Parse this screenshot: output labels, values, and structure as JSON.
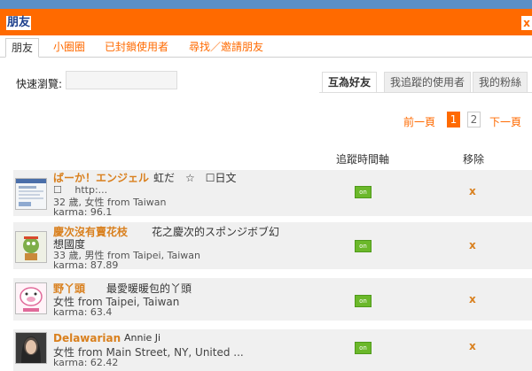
{
  "window": {
    "title": "朋友",
    "close_label": "x"
  },
  "nav_tabs": [
    {
      "label": "朋友"
    },
    {
      "label": "小圈圈"
    },
    {
      "label": "已封鎖使用者"
    },
    {
      "label": "尋找／邀請朋友"
    }
  ],
  "quick_browse": {
    "label": "快速瀏覽:",
    "value": ""
  },
  "filter_tabs": [
    {
      "label": "互為好友"
    },
    {
      "label": "我追蹤的使用者"
    },
    {
      "label": "我的粉絲"
    }
  ],
  "pager": {
    "prev": "前一頁",
    "next": "下一頁",
    "pages": [
      "1",
      "2"
    ],
    "current": "1"
  },
  "columns": {
    "follow_timeline": "追蹤時間軸",
    "remove": "移除"
  },
  "friends": [
    {
      "name": "ばーか！エンジェル",
      "desc": "虹だ　☆　☐日文",
      "extra": "☐　 http:...",
      "info": "32 歲, 女性 from Taiwan",
      "karma": "karma: 96.1",
      "toggle": "on",
      "remove": "x"
    },
    {
      "name": "慶次沒有賣花枝",
      "desc": "花之慶次的スポンジボブ幻",
      "extra": "想國度",
      "info": "33 歲, 男性 from Taipei, Taiwan",
      "karma": "karma: 87.89",
      "toggle": "on",
      "remove": "x"
    },
    {
      "name": "野丫頭",
      "desc": "最愛暖暖包的丫頭",
      "extra": "",
      "info": "女性 from Taipei, Taiwan",
      "karma": "karma: 63.4",
      "toggle": "on",
      "remove": "x"
    },
    {
      "name": "Delawarian",
      "desc": "Annie Ji",
      "extra": "",
      "info": "女性 from Main Street, NY, United ...",
      "karma": "karma: 62.42",
      "toggle": "on",
      "remove": "x"
    }
  ]
}
